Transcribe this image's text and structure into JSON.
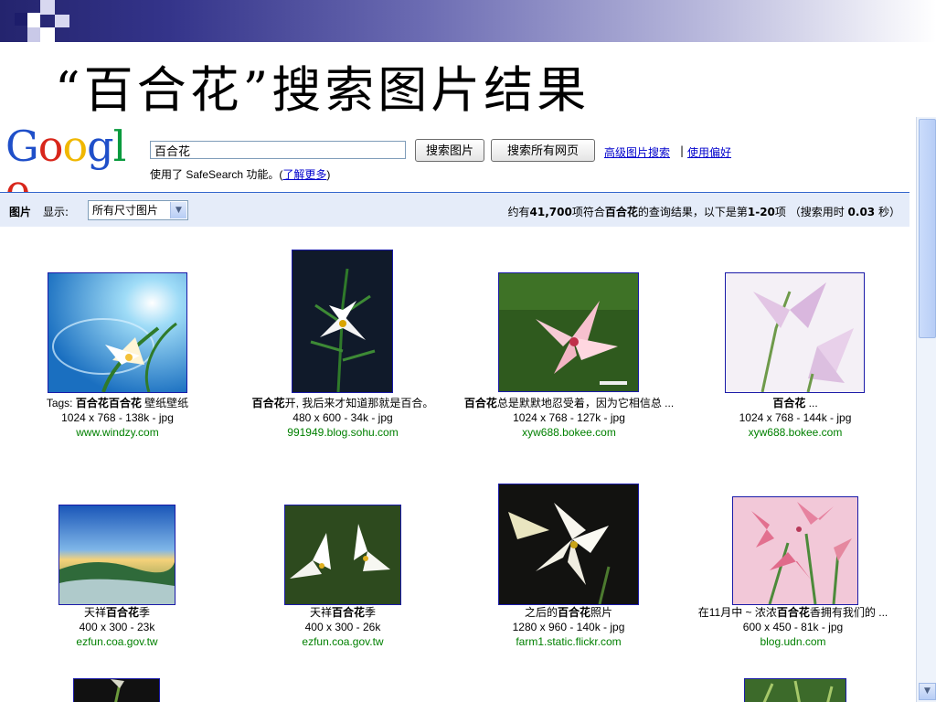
{
  "slide": {
    "title": "“百合花”搜索图片结果"
  },
  "logo": {
    "letters": [
      "G",
      "o",
      "o",
      "g",
      "l",
      "e"
    ],
    "colors": [
      "#1f4fc9",
      "#d8261b",
      "#f0b700",
      "#1f4fc9",
      "#0a9a3e",
      "#d8261b"
    ]
  },
  "search": {
    "query": "百合花",
    "btn_images": "搜索图片",
    "btn_all_web": "搜索所有网页",
    "link_advanced": "高级图片搜索",
    "link_sep": "|",
    "link_prefs": "使用偏好",
    "safesearch_prefix": "使用了 SafeSearch 功能。(",
    "safesearch_link": "了解更多",
    "safesearch_suffix": ")"
  },
  "results_bar": {
    "label": "图片",
    "show_label": "显示:",
    "size_option": "所有尺寸图片",
    "stats_pre": "约有",
    "stats_count": "41,700",
    "stats_mid1": "项符合",
    "stats_query": "百合花",
    "stats_mid2": "的查询结果，以下是第",
    "stats_range": "1-20",
    "stats_mid3": "项 （搜索用时",
    "stats_time": "0.03",
    "stats_post": "秒）"
  },
  "results": [
    {
      "title_pre": "Tags: ",
      "title_bold": "百合花百合花",
      "title_post": " 壁纸壁纸",
      "meta": "1024 x 768 - 138k - jpg",
      "site": "www.windzy.com"
    },
    {
      "title_pre": "",
      "title_bold": "百合花",
      "title_post": "开, 我后来才知道那就是百合。",
      "meta": "480 x 600 - 34k - jpg",
      "site": "991949.blog.sohu.com"
    },
    {
      "title_pre": "",
      "title_bold": "百合花",
      "title_post": "总是默默地忍受着，因为它相信总 ...",
      "meta": "1024 x 768 - 127k - jpg",
      "site": "xyw688.bokee.com"
    },
    {
      "title_pre": "",
      "title_bold": "百合花",
      "title_post": " ...",
      "meta": "1024 x 768 - 144k - jpg",
      "site": "xyw688.bokee.com"
    },
    {
      "title_pre": "天祥",
      "title_bold": "百合花",
      "title_post": "季",
      "meta": "400 x 300 - 23k",
      "site": "ezfun.coa.gov.tw"
    },
    {
      "title_pre": "天祥",
      "title_bold": "百合花",
      "title_post": "季",
      "meta": "400 x 300 - 26k",
      "site": "ezfun.coa.gov.tw"
    },
    {
      "title_pre": "之后的",
      "title_bold": "百合花",
      "title_post": "照片",
      "meta": "1280 x 960 - 140k - jpg",
      "site": "farm1.static.flickr.com"
    },
    {
      "title_pre": "在11月中 ~ 浓浓",
      "title_bold": "百合花",
      "title_post": "香拥有我们的 ...",
      "meta": "600 x 450 - 81k - jpg",
      "site": "blog.udn.com"
    }
  ]
}
